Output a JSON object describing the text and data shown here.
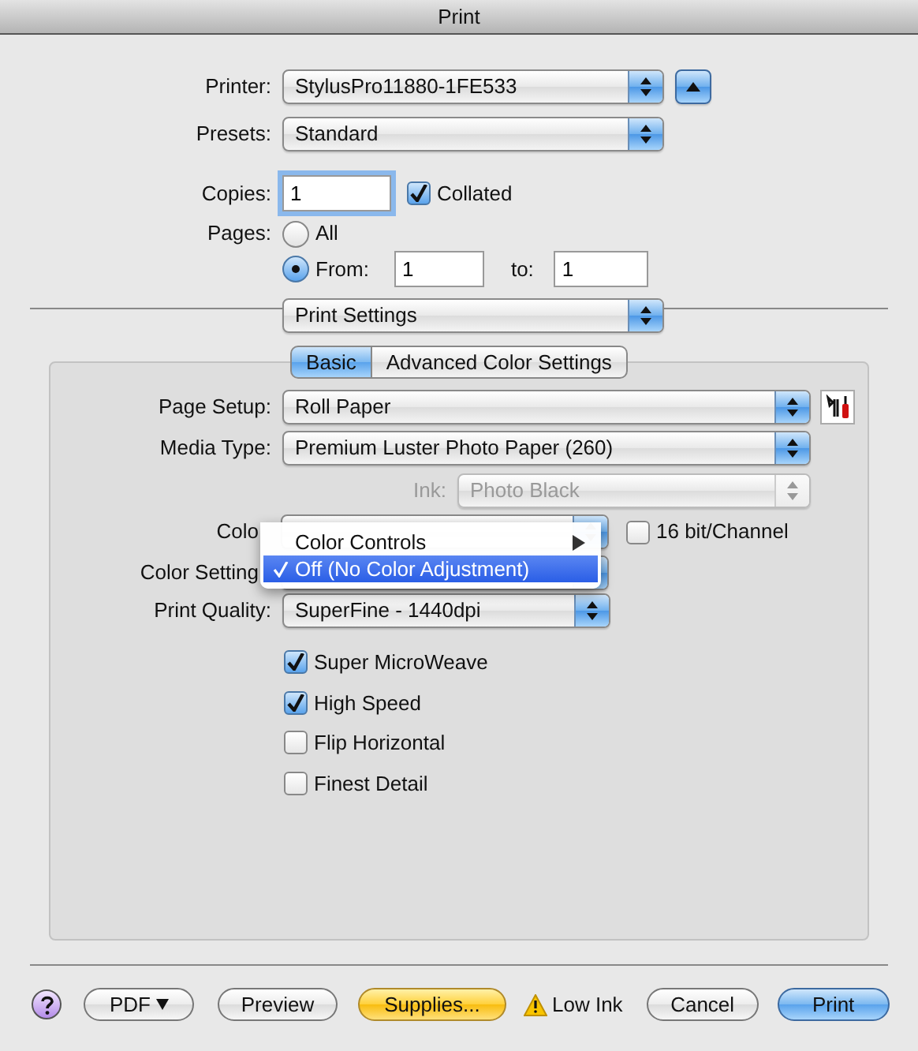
{
  "window": {
    "title": "Print"
  },
  "printer": {
    "label": "Printer:",
    "value": "StylusPro11880-1FE533"
  },
  "presets": {
    "label": "Presets:",
    "value": "Standard"
  },
  "copies": {
    "label": "Copies:",
    "value": "1",
    "collated": {
      "label": "Collated",
      "checked": true
    }
  },
  "pages": {
    "label": "Pages:",
    "options": [
      {
        "label": "All",
        "selected": false
      },
      {
        "label": "From:",
        "selected": true
      }
    ],
    "from": "1",
    "to_label": "to:",
    "to": "1"
  },
  "section": {
    "value": "Print Settings"
  },
  "tabs": [
    {
      "label": "Basic",
      "selected": true
    },
    {
      "label": "Advanced Color Settings",
      "selected": false
    }
  ],
  "page_setup": {
    "label": "Page Setup:",
    "value": "Roll Paper"
  },
  "media_type": {
    "label": "Media Type:",
    "value": "Premium Luster Photo Paper (260)"
  },
  "ink": {
    "label": "Ink:",
    "value": "Photo Black",
    "disabled": true
  },
  "color": {
    "label": "Colo",
    "bit16": {
      "label": "16 bit/Channel",
      "checked": false
    }
  },
  "color_settings": {
    "label": "Color Setting"
  },
  "print_quality": {
    "label": "Print Quality:",
    "value": "SuperFine - 1440dpi"
  },
  "options": [
    {
      "label": "Super MicroWeave",
      "checked": true
    },
    {
      "label": "High Speed",
      "checked": true
    },
    {
      "label": "Flip Horizontal",
      "checked": false
    },
    {
      "label": "Finest Detail",
      "checked": false
    }
  ],
  "menu": {
    "items": [
      {
        "label": "Color Controls",
        "submenu": true,
        "selected": false
      },
      {
        "label": "Off (No Color Adjustment)",
        "submenu": false,
        "selected": true
      }
    ]
  },
  "buttons": [
    {
      "kind": "pdf",
      "label": "PDF"
    },
    {
      "kind": "normal",
      "label": "Preview"
    },
    {
      "kind": "supplies",
      "label": "Supplies..."
    },
    {
      "kind": "warning",
      "label": "Low Ink"
    },
    {
      "kind": "normal",
      "label": "Cancel"
    },
    {
      "kind": "default",
      "label": "Print"
    }
  ]
}
